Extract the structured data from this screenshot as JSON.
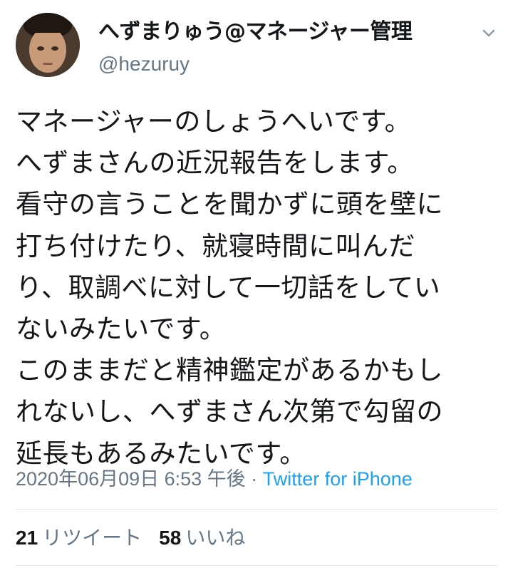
{
  "author": {
    "display_name": "へずまりゅう@マネージャー管理",
    "handle": "@hezuruy",
    "avatar_icon": "profile-photo"
  },
  "tweet": {
    "lines": [
      "マネージャーのしょうへいです。",
      "へずまさんの近況報告をします。",
      "看守の言うことを聞かずに頭を壁に",
      "打ち付けたり、就寝時間に叫んだ",
      "り、取調べに対して一切話をしてい",
      "ないみたいです。",
      "このままだと精神鑑定があるかもし",
      "れないし、へずまさん次第で勾留の",
      "延長もあるみたいです。"
    ]
  },
  "meta": {
    "timestamp": "2020年06月09日 6:53 午後",
    "separator": " · ",
    "source": "Twitter for iPhone"
  },
  "stats": {
    "retweets_count": "21",
    "retweets_label": "リツイート",
    "likes_count": "58",
    "likes_label": "いいね"
  },
  "colors": {
    "text": "#14171a",
    "secondary": "#657786",
    "link": "#1da1f2",
    "divider": "#e1e8ed"
  },
  "icons": {
    "menu": "chevron-down-icon"
  }
}
